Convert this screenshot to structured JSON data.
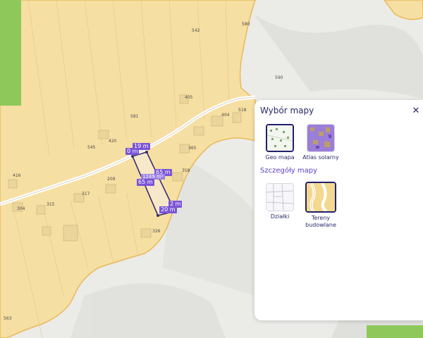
{
  "map": {
    "parcel_numbers": [
      {
        "text": "580"
      },
      {
        "text": "542"
      },
      {
        "text": "590"
      },
      {
        "text": "405"
      },
      {
        "text": "581"
      },
      {
        "text": "404"
      },
      {
        "text": "518"
      },
      {
        "text": "420"
      },
      {
        "text": "545"
      },
      {
        "text": "365"
      },
      {
        "text": "416"
      },
      {
        "text": "209"
      },
      {
        "text": "317"
      },
      {
        "text": "358"
      },
      {
        "text": "304"
      },
      {
        "text": "315"
      },
      {
        "text": "326"
      },
      {
        "text": "563"
      }
    ],
    "measurements": {
      "top_left": "0 m",
      "top_right": "19 m",
      "side_right": "65 m",
      "side_left": "65 m",
      "bottom_right": "2 m",
      "bottom_left": "20 m",
      "area": "1249 m²"
    },
    "colors": {
      "background_land": "#f6dfa2",
      "terrain": "#f1f1ef",
      "forest": "#8fc85a",
      "accent": "#7b55d6"
    }
  },
  "panel": {
    "title": "Wybór mapy",
    "close_icon": "close-icon",
    "base_maps": [
      {
        "label": "Geo mapa",
        "icon": "geo-map-thumbnail",
        "selected": true
      },
      {
        "label": "Atlas solarny",
        "icon": "solar-atlas-thumbnail",
        "selected": false
      }
    ],
    "details_title": "Szczegóły mapy",
    "detail_maps": [
      {
        "label": "Działki",
        "icon": "parcels-thumbnail",
        "selected": false
      },
      {
        "label": "Tereny budowlane",
        "icon": "building-land-thumbnail",
        "selected": true
      }
    ]
  }
}
